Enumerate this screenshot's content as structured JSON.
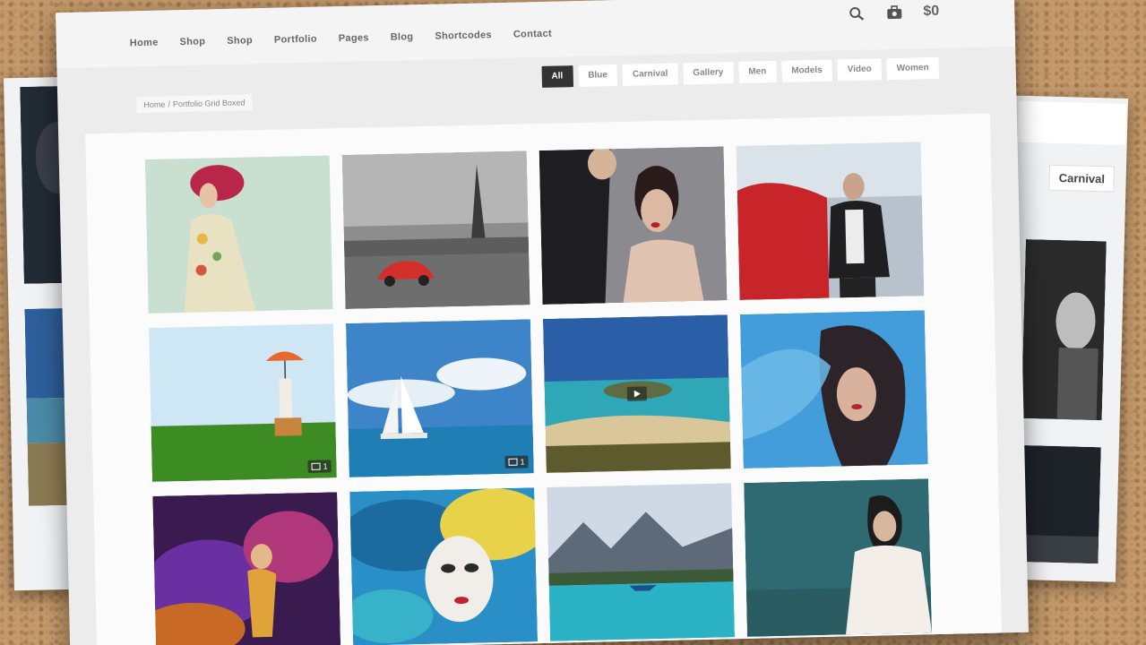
{
  "header": {
    "nav": [
      "Home",
      "Shop",
      "Shop",
      "Portfolio",
      "Pages",
      "Blog",
      "Shortcodes",
      "Contact"
    ],
    "icons": [
      "search-icon",
      "cart-icon"
    ],
    "cart_total": "$0"
  },
  "filters": {
    "items": [
      "All",
      "Blue",
      "Carnival",
      "Gallery",
      "Men",
      "Models",
      "Video",
      "Women"
    ],
    "active": "All"
  },
  "breadcrumb": {
    "items": [
      "Home",
      "Portfolio Grid Boxed"
    ]
  },
  "gallery": {
    "items": [
      {
        "name": "photo-redhead-model",
        "badge": ""
      },
      {
        "name": "photo-eiffel-red-car",
        "badge": ""
      },
      {
        "name": "photo-couple-tuxedo",
        "badge": ""
      },
      {
        "name": "photo-man-red-car",
        "badge": ""
      },
      {
        "name": "photo-umbrella-field",
        "badge": "1"
      },
      {
        "name": "photo-sailboat-sea",
        "badge": "1"
      },
      {
        "name": "photo-island-beach",
        "badge": ""
      },
      {
        "name": "photo-woman-blue-veil",
        "badge": ""
      },
      {
        "name": "photo-abstract-dancer",
        "badge": ""
      },
      {
        "name": "photo-carnival-mask",
        "badge": ""
      },
      {
        "name": "photo-mountain-lake",
        "badge": ""
      },
      {
        "name": "photo-woman-white-dress",
        "badge": ""
      }
    ]
  },
  "back_windows": {
    "right_filter_label": "Carnival"
  },
  "colors": {
    "background": "#c49a6c",
    "window": "#ececec",
    "active_filter": "#333333"
  }
}
